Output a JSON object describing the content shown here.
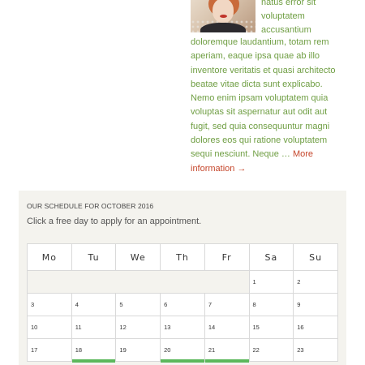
{
  "post": {
    "image_icon": "portrait-photo",
    "wrap_lines": [
      "natus error sit",
      "voluptatem",
      "accusantium"
    ],
    "body_lines": [
      "doloremque laudantium, totam rem",
      "aperiam, eaque ipsa quae ab illo",
      "inventore veritatis et quasi architecto",
      "beatae vitae dicta sunt explicabo.",
      "Nemo enim ipsam voluptatem quia",
      "voluptas sit aspernatur aut odit aut",
      "fugit, sed quia consequuntur magni",
      "dolores eos qui ratione voluptatem"
    ],
    "last_line_text": "sequi nesciunt. Neque … ",
    "more_inline": "More",
    "more_continued": "information →",
    "text_color": "#6f9e43",
    "link_color": "#c5462b"
  },
  "schedule": {
    "title": "OUR SCHEDULE FOR OCTOBER 2016",
    "subtitle": "Click a free day to apply for an appointment.",
    "available_color": "#5cb85c",
    "weekdays": [
      "Mo",
      "Tu",
      "We",
      "Th",
      "Fr",
      "Sa",
      "Su"
    ],
    "weeks": [
      [
        "",
        "",
        "",
        "",
        "",
        "1",
        "2"
      ],
      [
        "3",
        "4",
        "5",
        "6",
        "7",
        "8",
        "9"
      ],
      [
        "10",
        "11",
        "12",
        "13",
        "14",
        "15",
        "16"
      ],
      [
        "17",
        "18",
        "19",
        "20",
        "21",
        "22",
        "23"
      ]
    ],
    "available_days": [
      "18",
      "20",
      "21"
    ]
  }
}
